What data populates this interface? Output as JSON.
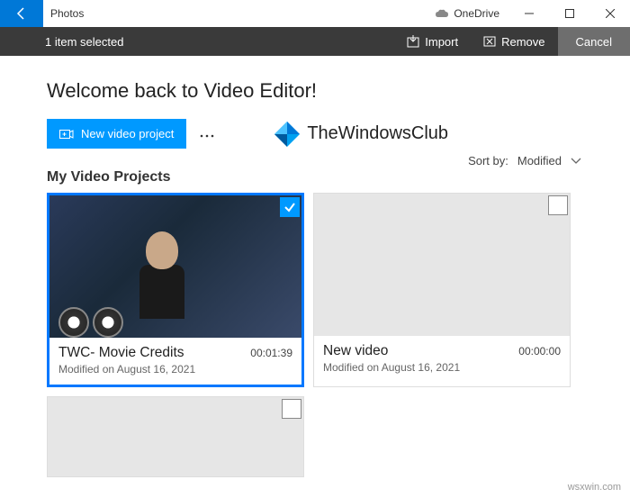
{
  "titlebar": {
    "app_title": "Photos",
    "onedrive": "OneDrive"
  },
  "toolbar": {
    "selection": "1 item selected",
    "import": "Import",
    "remove": "Remove",
    "cancel": "Cancel"
  },
  "header": {
    "welcome": "Welcome back to Video Editor!",
    "new_project": "New video project"
  },
  "logo": {
    "text": "TheWindowsClub"
  },
  "sort": {
    "label": "Sort by:",
    "value": "Modified"
  },
  "section": {
    "title": "My Video Projects"
  },
  "projects": [
    {
      "name": "TWC- Movie Credits",
      "duration": "00:01:39",
      "modified": "Modified on August 16, 2021",
      "selected": true
    },
    {
      "name": "New video",
      "duration": "00:00:00",
      "modified": "Modified on August 16, 2021",
      "selected": false
    }
  ],
  "watermark": "wsxwin.com"
}
